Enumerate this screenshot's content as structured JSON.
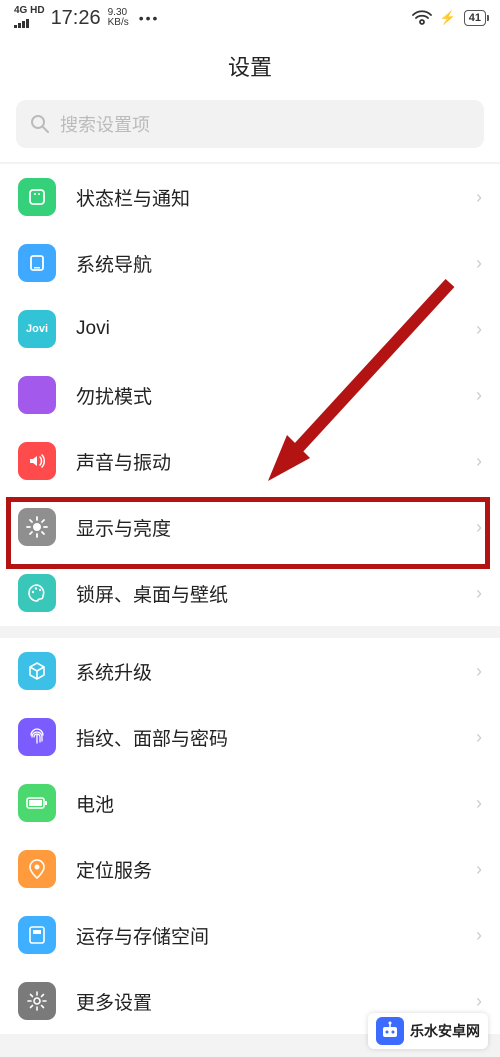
{
  "status": {
    "network": "4G HD",
    "time": "17:26",
    "speed_num": "9.30",
    "speed_unit": "KB/s",
    "battery": "41"
  },
  "header": {
    "title": "设置"
  },
  "search": {
    "placeholder": "搜索设置项"
  },
  "groups": [
    {
      "items": [
        {
          "key": "status-notif",
          "label": "状态栏与通知",
          "icon": "square-dots-icon",
          "bg": "bg-green1"
        },
        {
          "key": "nav",
          "label": "系统导航",
          "icon": "nav-icon",
          "bg": "bg-blue1"
        },
        {
          "key": "jovi",
          "label": "Jovi",
          "icon": "jovi-icon",
          "bg": "bg-teal"
        },
        {
          "key": "dnd",
          "label": "勿扰模式",
          "icon": "moon-icon",
          "bg": "bg-purple"
        },
        {
          "key": "sound",
          "label": "声音与振动",
          "icon": "speaker-icon",
          "bg": "bg-red"
        },
        {
          "key": "display",
          "label": "显示与亮度",
          "icon": "brightness-icon",
          "bg": "bg-gray"
        },
        {
          "key": "lock",
          "label": "锁屏、桌面与壁纸",
          "icon": "palette-icon",
          "bg": "bg-cyan"
        }
      ]
    },
    {
      "items": [
        {
          "key": "update",
          "label": "系统升级",
          "icon": "cube-icon",
          "bg": "bg-cyan2"
        },
        {
          "key": "biometrics",
          "label": "指纹、面部与密码",
          "icon": "fingerprint-icon",
          "bg": "bg-purple2"
        },
        {
          "key": "battery",
          "label": "电池",
          "icon": "battery-icon",
          "bg": "bg-green2"
        },
        {
          "key": "location",
          "label": "定位服务",
          "icon": "location-icon",
          "bg": "bg-orange"
        },
        {
          "key": "storage",
          "label": "运存与存储空间",
          "icon": "storage-icon",
          "bg": "bg-blue2"
        },
        {
          "key": "more",
          "label": "更多设置",
          "icon": "gear-icon",
          "bg": "bg-gray2"
        }
      ]
    }
  ],
  "annotation": {
    "highlighted_item": "display"
  },
  "watermark": {
    "text": "乐水安卓网"
  }
}
